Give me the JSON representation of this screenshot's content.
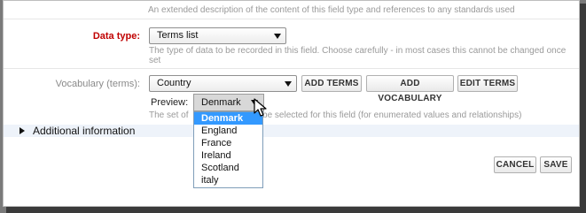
{
  "top_hint": "An extended description of the content of this field type and references to any standards used",
  "data_type": {
    "label": "Data type:",
    "selected": "Terms list",
    "hint": "The type of data to be recorded in this field. Choose carefully - in most cases this cannot be changed once set"
  },
  "vocabulary": {
    "label": "Vocabulary (terms):",
    "selected": "Country",
    "buttons": {
      "add_terms": "ADD TERMS",
      "add_vocabulary": "ADD VOCABULARY",
      "edit_terms": "EDIT TERMS"
    },
    "preview_label": "Preview:",
    "preview_selected": "Denmark",
    "hint_start": "The set of",
    "hint_end": "be selected for this field (for enumerated values and relationships)",
    "options": [
      "Denmark",
      "England",
      "France",
      "Ireland",
      "Scotland",
      "italy"
    ],
    "highlighted_option": "Denmark"
  },
  "additional_information": "Additional information",
  "footer_buttons": {
    "cancel": "CANCEL",
    "save": "SAVE"
  },
  "colors": {
    "required_label": "#c00000",
    "highlight": "#3399ff",
    "section_bg": "#eef3fa"
  }
}
